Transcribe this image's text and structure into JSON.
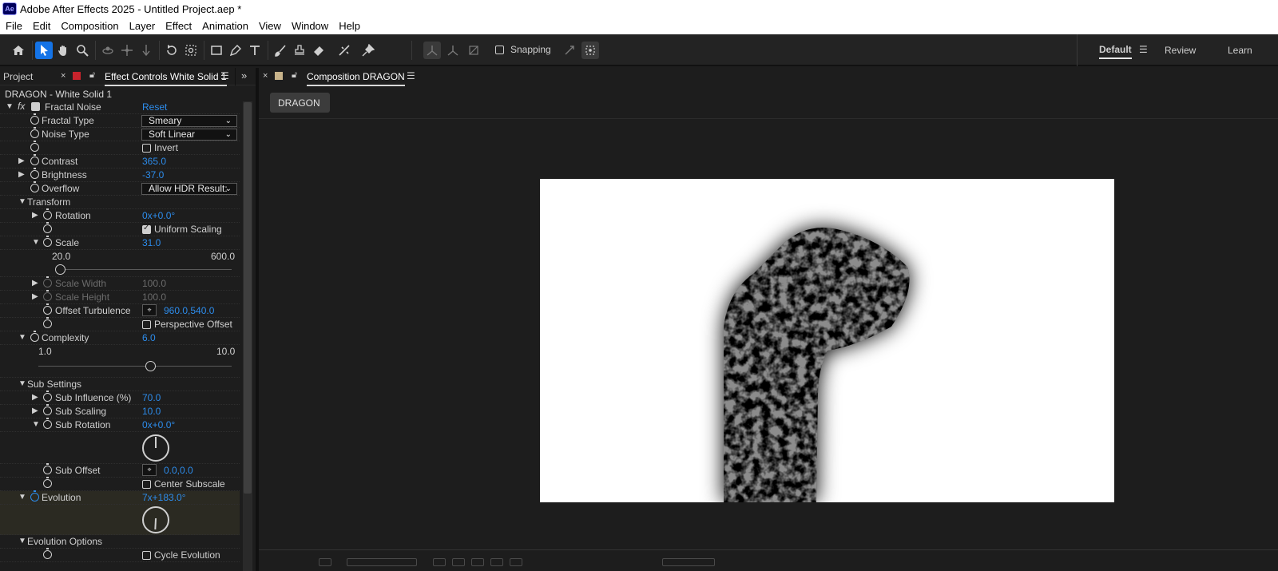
{
  "app": {
    "title": "Adobe After Effects 2025 - Untitled Project.aep *",
    "logo": "Ae"
  },
  "menu": [
    "File",
    "Edit",
    "Composition",
    "Layer",
    "Effect",
    "Animation",
    "View",
    "Window",
    "Help"
  ],
  "toolbar": {
    "tools": [
      "home-icon",
      "selection-tool-icon",
      "hand-tool-icon",
      "zoom-tool-icon",
      "orbit-camera-icon",
      "pan-camera-icon",
      "dolly-camera-icon",
      "rotation-tool-icon",
      "pan-behind-icon",
      "rectangle-tool-icon",
      "pen-tool-icon",
      "type-tool-icon",
      "brush-tool-icon",
      "clone-stamp-icon",
      "eraser-icon",
      "roto-brush-icon",
      "puppet-pin-icon"
    ],
    "snapping_label": "Snapping"
  },
  "workspaces": {
    "default": "Default",
    "review": "Review",
    "learn": "Learn"
  },
  "left_panel": {
    "project_tab": "Project",
    "effect_controls_tab": "Effect Controls White Solid 1",
    "layer_title": "DRAGON - White Solid 1",
    "effect_name": "Fractal Noise",
    "reset_label": "Reset",
    "properties": {
      "fractal_type": {
        "label": "Fractal Type",
        "value": "Smeary"
      },
      "noise_type": {
        "label": "Noise Type",
        "value": "Soft Linear"
      },
      "invert": {
        "label": "Invert",
        "checked": false
      },
      "contrast": {
        "label": "Contrast",
        "value": "365.0"
      },
      "brightness": {
        "label": "Brightness",
        "value": "-37.0"
      },
      "overflow": {
        "label": "Overflow",
        "value": "Allow HDR Result:"
      },
      "transform": {
        "label": "Transform"
      },
      "rotation": {
        "label": "Rotation",
        "value": "0x+0.0°"
      },
      "uniform_scaling": {
        "label": "Uniform Scaling",
        "checked": true
      },
      "scale": {
        "label": "Scale",
        "value": "31.0",
        "min": "20.0",
        "max": "600.0"
      },
      "scale_width": {
        "label": "Scale Width",
        "value": "100.0"
      },
      "scale_height": {
        "label": "Scale Height",
        "value": "100.0"
      },
      "offset_turbulence": {
        "label": "Offset Turbulence",
        "value": "960.0,540.0"
      },
      "perspective_offset": {
        "label": "Perspective Offset",
        "checked": false
      },
      "complexity": {
        "label": "Complexity",
        "value": "6.0",
        "min": "1.0",
        "max": "10.0"
      },
      "sub_settings": {
        "label": "Sub Settings"
      },
      "sub_influence": {
        "label": "Sub Influence (%)",
        "value": "70.0"
      },
      "sub_scaling": {
        "label": "Sub Scaling",
        "value": "10.0"
      },
      "sub_rotation": {
        "label": "Sub Rotation",
        "value": "0x+0.0°"
      },
      "sub_offset": {
        "label": "Sub Offset",
        "value": "0.0,0.0"
      },
      "center_subscale": {
        "label": "Center Subscale",
        "checked": false
      },
      "evolution": {
        "label": "Evolution",
        "value": "7x+183.0°"
      },
      "evolution_options": {
        "label": "Evolution Options"
      },
      "cycle_evolution": {
        "label": "Cycle Evolution",
        "checked": false
      }
    }
  },
  "composition": {
    "tab_label": "Composition DRAGON",
    "breadcrumb": "DRAGON",
    "viewer_bg": "#ffffff",
    "shape_color": "#000000"
  },
  "colors": {
    "accent": "#2d8ceb",
    "active_tool": "#1473e6",
    "panel": "#1d1d1d"
  }
}
